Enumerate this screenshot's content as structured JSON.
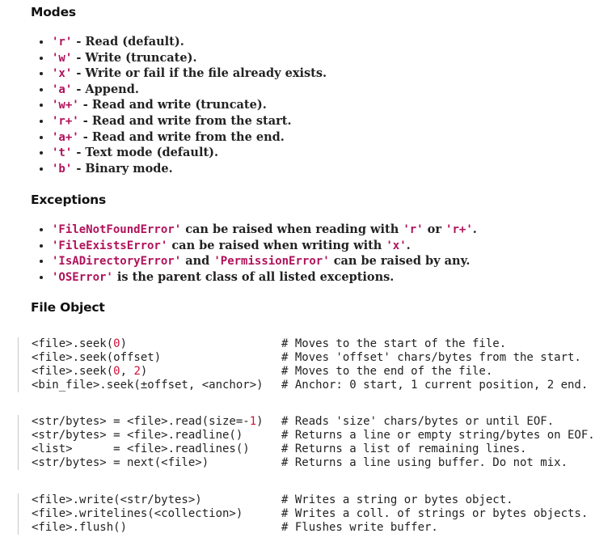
{
  "modes": {
    "heading": "Modes",
    "items": [
      {
        "code": "'r'",
        "desc": " - Read (default)."
      },
      {
        "code": "'w'",
        "desc": " - Write (truncate)."
      },
      {
        "code": "'x'",
        "desc": " - Write or fail if the file already exists."
      },
      {
        "code": "'a'",
        "desc": " - Append."
      },
      {
        "code": "'w+'",
        "desc": " - Read and write (truncate)."
      },
      {
        "code": "'r+'",
        "desc": " - Read and write from the start."
      },
      {
        "code": "'a+'",
        "desc": " - Read and write from the end."
      },
      {
        "code": "'t'",
        "desc": " - Text mode (default)."
      },
      {
        "code": "'b'",
        "desc": " - Binary mode."
      }
    ]
  },
  "exceptions": {
    "heading": "Exceptions",
    "items": [
      {
        "parts": [
          {
            "code": "'FileNotFoundError'"
          },
          {
            "text": " can be raised when reading with "
          },
          {
            "code": "'r'"
          },
          {
            "text": " or "
          },
          {
            "code": "'r+'"
          },
          {
            "text": "."
          }
        ]
      },
      {
        "parts": [
          {
            "code": "'FileExistsError'"
          },
          {
            "text": " can be raised when writing with "
          },
          {
            "code": "'x'"
          },
          {
            "text": "."
          }
        ]
      },
      {
        "parts": [
          {
            "code": "'IsADirectoryError'"
          },
          {
            "text": " and "
          },
          {
            "code": "'PermissionError'"
          },
          {
            "text": " can be raised by any."
          }
        ]
      },
      {
        "parts": [
          {
            "code": "'OSError'"
          },
          {
            "text": " is the parent class of all listed exceptions."
          }
        ]
      }
    ]
  },
  "file_object": {
    "heading": "File Object",
    "blocks": [
      [
        {
          "code": [
            {
              "t": "<file>.seek("
            },
            {
              "n": "0"
            },
            {
              "t": ")"
            }
          ],
          "comment": "# Moves to the start of the file."
        },
        {
          "code": [
            {
              "t": "<file>.seek(offset)"
            }
          ],
          "comment": "# Moves 'offset' chars/bytes from the start."
        },
        {
          "code": [
            {
              "t": "<file>.seek("
            },
            {
              "n": "0"
            },
            {
              "t": ", "
            },
            {
              "n": "2"
            },
            {
              "t": ")"
            }
          ],
          "comment": "# Moves to the end of the file."
        },
        {
          "code": [
            {
              "t": "<bin_file>.seek(±offset, <anchor>)"
            }
          ],
          "comment": "# Anchor: 0 start, 1 current position, 2 end."
        }
      ],
      [
        {
          "code": [
            {
              "t": "<str/bytes> = <file>.read(size=-"
            },
            {
              "n": "1"
            },
            {
              "t": ")"
            }
          ],
          "comment": "# Reads 'size' chars/bytes or until EOF."
        },
        {
          "code": [
            {
              "t": "<str/bytes> = <file>.readline()"
            }
          ],
          "comment": "# Returns a line or empty string/bytes on EOF."
        },
        {
          "code": [
            {
              "t": "<list>      = <file>.readlines()"
            }
          ],
          "comment": "# Returns a list of remaining lines."
        },
        {
          "code": [
            {
              "t": "<str/bytes> = next(<file>)"
            }
          ],
          "comment": "# Returns a line using buffer. Do not mix."
        }
      ],
      [
        {
          "code": [
            {
              "t": "<file>.write(<str/bytes>)"
            }
          ],
          "comment": "# Writes a string or bytes object."
        },
        {
          "code": [
            {
              "t": "<file>.writelines(<collection>)"
            }
          ],
          "comment": "# Writes a coll. of strings or bytes objects."
        },
        {
          "code": [
            {
              "t": "<file>.flush()"
            }
          ],
          "comment": "# Flushes write buffer."
        }
      ]
    ]
  }
}
